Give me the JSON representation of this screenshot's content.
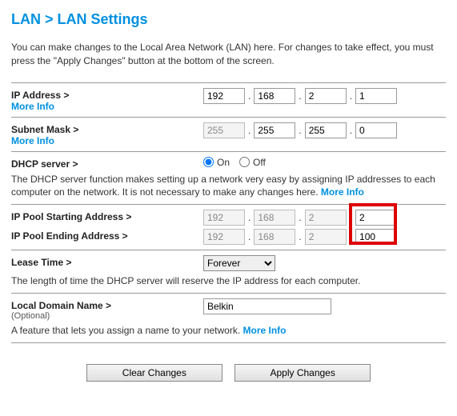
{
  "title": "LAN > LAN Settings",
  "intro": "You can make changes to the Local Area Network (LAN) here. For changes to take effect, you must press the \"Apply Changes\" button at the bottom of the screen.",
  "more_info": "More Info",
  "dot": ".",
  "ip_address": {
    "label": "IP Address >",
    "oct1": "192",
    "oct2": "168",
    "oct3": "2",
    "oct4": "1"
  },
  "subnet": {
    "label": "Subnet Mask >",
    "oct1": "255",
    "oct2": "255",
    "oct3": "255",
    "oct4": "0",
    "disabled1": true
  },
  "dhcp": {
    "label": "DHCP server >",
    "on_label": "On",
    "off_label": "Off",
    "selected": "on",
    "desc_prefix": "The DHCP server function makes setting up a network very easy by assigning IP addresses to each computer on the network. It is not necessary to make any changes here. "
  },
  "pool_start": {
    "label": "IP Pool Starting Address >",
    "oct1": "192",
    "oct2": "168",
    "oct3": "2",
    "oct4": "2"
  },
  "pool_end": {
    "label": "IP Pool Ending Address >",
    "oct1": "192",
    "oct2": "168",
    "oct3": "2",
    "oct4": "100"
  },
  "lease": {
    "label": "Lease Time >",
    "value": "Forever",
    "desc": "The length of time the DHCP server will reserve the IP address for each computer."
  },
  "domain": {
    "label": "Local Domain Name >",
    "sub": "(Optional)",
    "value": "Belkin",
    "desc_prefix": "A feature that lets you assign a name to your network. "
  },
  "buttons": {
    "clear": "Clear Changes",
    "apply": "Apply Changes"
  }
}
